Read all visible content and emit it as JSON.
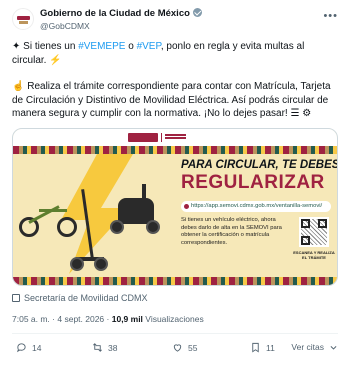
{
  "post": {
    "author_name": "Gobierno de la Ciudad de México",
    "handle": "@GobCDMX",
    "paragraph1_prefix": "✦ Si tienes un ",
    "hashtag1": "#VEMEPE",
    "paragraph1_mid": " o ",
    "hashtag2": "#VEP",
    "paragraph1_suffix": ", ponlo en regla y evita multas al circular. ⚡",
    "paragraph2": "☝ Realiza el trámite correspondiente para contar con Matrícula, Tarjeta de Circulación y Distintivo de Movilidad Eléctrica. Así podrás circular de manera segura y cumplir con la normativa. ¡No lo dejes pasar! ☰ ⚙",
    "source_label": "Secretaría de Movilidad CDMX",
    "time": "7:05 a. m.",
    "date": "4 sept. 2026",
    "views_count": "10,9 mil",
    "views_label": "Visualizaciones"
  },
  "image": {
    "headline1": "PARA CIRCULAR, TE DEBES",
    "headline2": "REGULARIZAR",
    "url": "https://app.semovi.cdmx.gob.mx/ventanilla-semovi/",
    "body": "Si tienes un vehículo eléctrico, ahora debes darlo de alta en la SEMOVI para obtener la certificación o matrícula correspondientes.",
    "qr_label": "ESCANEA Y REALIZA EL TRÁMITE"
  },
  "actions": {
    "replies": "14",
    "reposts": "38",
    "likes": "55",
    "bookmarks": "11",
    "quotes_label": "Ver citas"
  },
  "colors": {
    "brand": "#9f2241",
    "gold": "#bc955c",
    "link": "#1d9bf0",
    "muted": "#536471"
  }
}
